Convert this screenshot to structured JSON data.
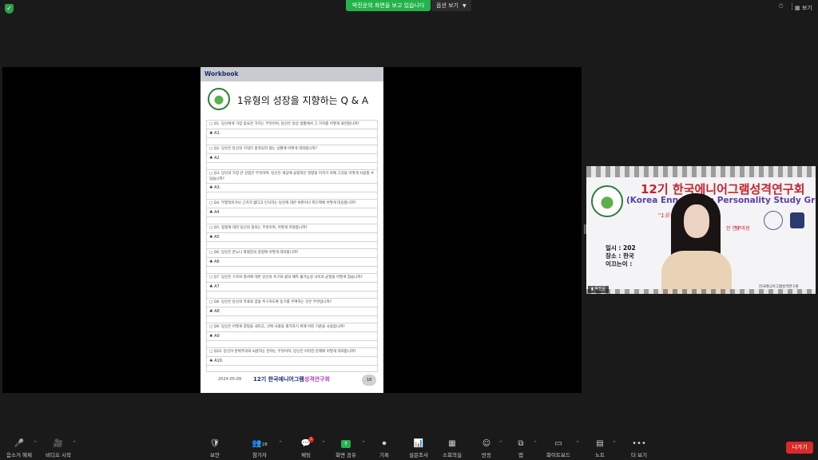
{
  "topbar": {
    "shield_icon": "shield-check-icon",
    "share_banner": "박진운의 화면을 보고 있습니다",
    "view_options": "옵션 보기",
    "view_label": "보기"
  },
  "workbook": {
    "header": "Workbook",
    "title": "1유형의 성장을 지향하는 Q & A",
    "questions": [
      {
        "q": "□ Q1. 당신에게 가장 중요한 가치는 무엇이며, 당신은 일상 생활에서 그 가치를 어떻게 표현합니까?",
        "a": "♣ A1.",
        "tall": false
      },
      {
        "q": "□ Q2. 당신은 당신의 기대가 충족되지 않는 상황에 어떻게 대처합니까?",
        "a": "♣ A2",
        "tall": false
      },
      {
        "q": "□ Q3. 당신의 가장 큰 강점은 무엇이며, 당신은 세상에 긍정적인 영향을 미치기 위해 그것을 어떻게 사용할 수 있습니까?",
        "a": "♣ A3.",
        "tall": true
      },
      {
        "q": "□ Q4. 부정적이거나 근거가 없다고 인식하는 당신에 대한 비판이나 피드백에 어떻게 대응합니까?",
        "a": "♣ A4",
        "tall": false
      },
      {
        "q": "□ Q5. 정중에 대한 당신의 정의는 무엇이며, 어떻게 측정합니까?",
        "a": "♣ A5",
        "tall": false
      },
      {
        "q": "□ Q6. 당신은 분노나 좌절감의 감정에 어떻게 대처합니까?",
        "a": "♣ A6",
        "tall": false
      },
      {
        "q": "□ Q7. 당신은 구조와 질서에 대한 당신의 욕구와 삶의 예측 불가능성 사이의 균형을 어떻게 잡습니까?",
        "a": "♣ A7",
        "tall": false
      },
      {
        "q": "□ Q8. 당신은 당신의 목표와 꿈을 추구하도록 동기를 부여하는 것은 무엇입니까?",
        "a": "♣ A8",
        "tall": false
      },
      {
        "q": "□ Q9. 당신은 어떻게 결정을 내리고, 선택 사항을 평가하기 위해 어떤 기준을 사용합니까?",
        "a": "♣ A9",
        "tall": false
      },
      {
        "q": "□ Q10. 당신이 완벽주의와 씨름하는 분야는 무엇이며, 당신은 이러한 문제에 어떻게 대처합니까?",
        "a": "♣ A10.",
        "tall": false
      }
    ],
    "footer_date": "2024-05-09",
    "footer_brand_a": "12기 한국에니어그램",
    "footer_brand_b": "성격연구회",
    "page_number": "18"
  },
  "video": {
    "title": "12기 한국에니어그램성격연구회",
    "subtitle": "(Korea Enneagram Personality Study Group)",
    "line1": "\"1유형의",
    "line2": "한 연구과정",
    "line3": "향\"",
    "info": [
      "일시 : 202",
      "장소 : 한국",
      "이끄는이 :"
    ],
    "org": "한국에니어그램성격연구원",
    "name_tag": "박진운"
  },
  "toolbar": {
    "items": [
      {
        "name": "unmute",
        "icon": "🎤",
        "label": "음소거 해제"
      },
      {
        "name": "start-video",
        "icon": "🎥",
        "label": "비디오 시작"
      },
      {
        "name": "security",
        "icon": "🛡",
        "label": "보안"
      },
      {
        "name": "participants",
        "icon": "👥",
        "label": "참가자",
        "count": "28"
      },
      {
        "name": "chat",
        "icon": "💬",
        "label": "채팅",
        "badge": "5"
      },
      {
        "name": "share-screen",
        "icon": "↑",
        "label": "화면 공유"
      },
      {
        "name": "record",
        "icon": "⏺",
        "label": "기록"
      },
      {
        "name": "polls",
        "icon": "📊",
        "label": "설문조사"
      },
      {
        "name": "breakout-rooms",
        "icon": "▦",
        "label": "소회의실"
      },
      {
        "name": "reactions",
        "icon": "☺",
        "label": "반응"
      },
      {
        "name": "apps",
        "icon": "⧉",
        "label": "앱"
      },
      {
        "name": "whiteboard",
        "icon": "▭",
        "label": "화이트보드"
      },
      {
        "name": "notes",
        "icon": "▤",
        "label": "노트"
      },
      {
        "name": "more",
        "icon": "•••",
        "label": "더 보기"
      }
    ],
    "leave": "나가기"
  }
}
